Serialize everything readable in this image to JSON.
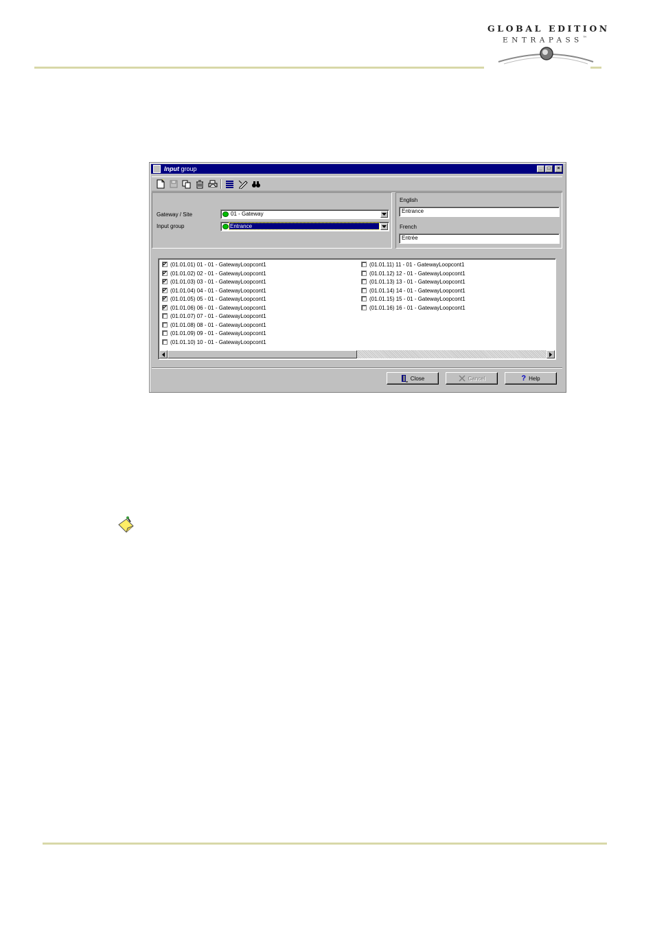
{
  "header": {
    "logo_line1": "GLOBAL EDITION",
    "logo_line2": "ENTRAPASS",
    "logo_tm": "™"
  },
  "window": {
    "title_italic": "Input",
    "title_rest": " group",
    "min_glyph": "_",
    "max_glyph": "□",
    "close_glyph": "×"
  },
  "toolbar": {
    "items": [
      "new-icon",
      "save-icon",
      "copy-icon",
      "delete-icon",
      "print-icon",
      "list-icon",
      "edit-icon",
      "find-icon"
    ]
  },
  "form": {
    "gateway_label": "Gateway / Site",
    "gateway_value": "01 - Gateway",
    "input_group_label": "Input group",
    "input_group_value": "Entrance",
    "english_label": "English",
    "english_value": "Entrance",
    "french_label": "French",
    "french_value": "Entrée"
  },
  "inputs_left": [
    {
      "label": "(01.01.01) 01 - 01 - GatewayLoopcont1",
      "checked": true
    },
    {
      "label": "(01.01.02) 02 - 01 - GatewayLoopcont1",
      "checked": true
    },
    {
      "label": "(01.01.03) 03 - 01 - GatewayLoopcont1",
      "checked": true
    },
    {
      "label": "(01.01.04) 04 - 01 - GatewayLoopcont1",
      "checked": true
    },
    {
      "label": "(01.01.05) 05 - 01 - GatewayLoopcont1",
      "checked": true
    },
    {
      "label": "(01.01.06) 06 - 01 - GatewayLoopcont1",
      "checked": true
    },
    {
      "label": "(01.01.07) 07 - 01 - GatewayLoopcont1",
      "checked": false
    },
    {
      "label": "(01.01.08) 08 - 01 - GatewayLoopcont1",
      "checked": false
    },
    {
      "label": "(01.01.09) 09 - 01 - GatewayLoopcont1",
      "checked": false
    },
    {
      "label": "(01.01.10) 10 - 01 - GatewayLoopcont1",
      "checked": false
    }
  ],
  "inputs_right": [
    {
      "label": "(01.01.11) 11 - 01 - GatewayLoopcont1",
      "checked": false
    },
    {
      "label": "(01.01.12) 12 - 01 - GatewayLoopcont1",
      "checked": false
    },
    {
      "label": "(01.01.13) 13 - 01 - GatewayLoopcont1",
      "checked": false
    },
    {
      "label": "(01.01.14) 14 - 01 - GatewayLoopcont1",
      "checked": false
    },
    {
      "label": "(01.01.15) 15 - 01 - GatewayLoopcont1",
      "checked": false
    },
    {
      "label": "(01.01.16) 16 - 01 - GatewayLoopcont1",
      "checked": false
    }
  ],
  "buttons": {
    "close": "Close",
    "cancel": "Cancel",
    "help": "Help"
  }
}
